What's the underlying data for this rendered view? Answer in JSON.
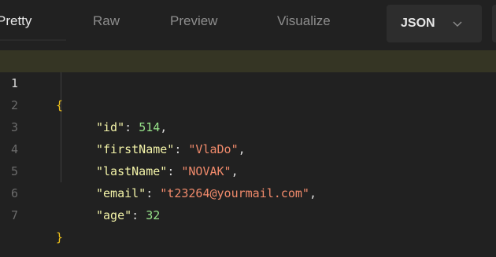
{
  "toolbar": {
    "tabs": [
      {
        "label": "Pretty",
        "active": true
      },
      {
        "label": "Raw",
        "active": false
      },
      {
        "label": "Preview",
        "active": false
      },
      {
        "label": "Visualize",
        "active": false
      }
    ],
    "format_select": {
      "value": "JSON",
      "icon": "chevron-down-icon"
    }
  },
  "code": {
    "line_numbers": [
      "1",
      "2",
      "3",
      "4",
      "5",
      "6",
      "7"
    ],
    "open_brace": "{",
    "close_brace": "}",
    "fields": [
      {
        "key": "\"id\"",
        "value": "514",
        "value_type": "number",
        "trailing": ","
      },
      {
        "key": "\"firstName\"",
        "value": "\"VlaDo\"",
        "value_type": "string",
        "trailing": ","
      },
      {
        "key": "\"lastName\"",
        "value": "\"NOVAK\"",
        "value_type": "string",
        "trailing": ","
      },
      {
        "key": "\"email\"",
        "value": "\"t23264@yourmail.com\"",
        "value_type": "string",
        "trailing": ","
      },
      {
        "key": "\"age\"",
        "value": "32",
        "value_type": "number",
        "trailing": ""
      }
    ],
    "colon": ": "
  },
  "colors": {
    "background": "#212121",
    "active_line": "#353524",
    "brace": "#f0c21a",
    "key": "#f3f3a8",
    "number": "#97e38a",
    "string": "#f08a6b"
  }
}
